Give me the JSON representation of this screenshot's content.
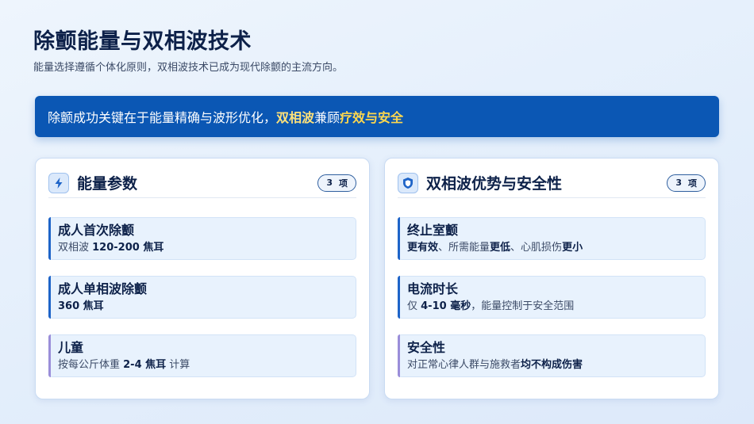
{
  "header": {
    "title": "除颤能量与双相波技术",
    "subtitle": "能量选择遵循个体化原则，双相波技术已成为现代除颤的主流方向。"
  },
  "banner": {
    "text_prefix": "除颤成功关键在于能量精确与波形优化，",
    "highlight_1": "双相波",
    "text_middle": "兼顾",
    "highlight_2": "疗效与安全"
  },
  "left_card": {
    "icon": "lightning-icon",
    "title": "能量参数",
    "badge_count": "3",
    "badge_unit": "项",
    "items": [
      {
        "title": "成人首次除颤",
        "desc_prefix": "双相波 ",
        "desc_bold": "120-200 焦耳",
        "desc_suffix": ""
      },
      {
        "title": "成人单相波除颤",
        "desc_prefix": "",
        "desc_bold": "360 焦耳",
        "desc_suffix": ""
      },
      {
        "title": "儿童",
        "desc_prefix": "按每公斤体重 ",
        "desc_bold": "2-4 焦耳",
        "desc_suffix": " 计算"
      }
    ]
  },
  "right_card": {
    "icon": "shield-icon",
    "title": "双相波优势与安全性",
    "badge_count": "3",
    "badge_unit": "项",
    "items": [
      {
        "title": "终止室颤",
        "d1_bold": "更有效",
        "d2": "、所需能量",
        "d3_bold": "更低",
        "d4": "、心肌损伤",
        "d5_bold": "更小"
      },
      {
        "title": "电流时长",
        "desc_prefix": "仅 ",
        "desc_bold": "4-10 毫秒",
        "desc_suffix": "，能量控制于安全范围"
      },
      {
        "title": "安全性",
        "desc_prefix": "对正常心律人群与施救者",
        "desc_bold": "均不构成伤害",
        "desc_suffix": ""
      }
    ]
  },
  "colors": {
    "banner_bg": "#0b57b4",
    "highlight": "#ffd84d",
    "accent_bar": "#1e64c8",
    "accent_bar_last": "#9a8ed9"
  }
}
